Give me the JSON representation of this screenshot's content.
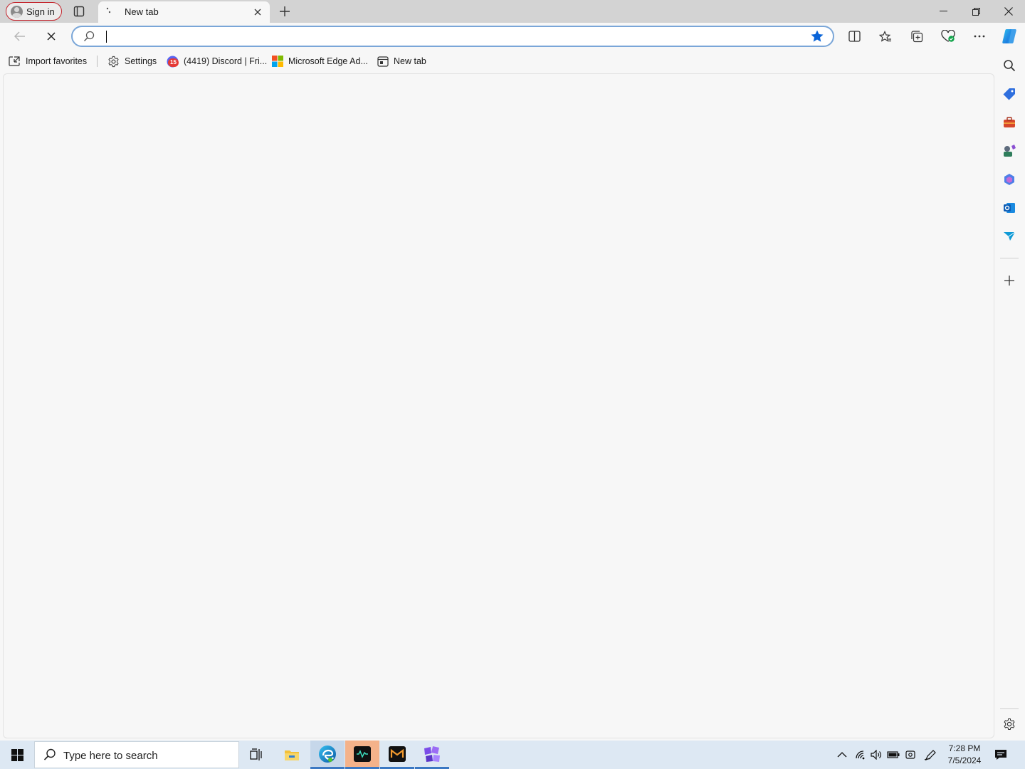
{
  "titlebar": {
    "signin_label": "Sign in",
    "tab_title": "New tab",
    "icons": [
      "profile-avatar-icon",
      "tab-actions-icon",
      "loading-icon",
      "close-icon",
      "plus-icon",
      "minimize-icon",
      "restore-icon",
      "window-close-icon"
    ]
  },
  "toolbar": {
    "address_value": "",
    "icons": [
      "back-arrow-icon",
      "stop-loading-icon",
      "search-icon",
      "favorite-star-icon",
      "split-screen-icon",
      "favorites-icon",
      "collections-icon",
      "browser-essentials-icon",
      "more-icon",
      "copilot-icon"
    ]
  },
  "favorites": [
    {
      "label": "Import favorites",
      "icon": "import-icon"
    },
    {
      "label": "Settings",
      "icon": "gear-icon"
    },
    {
      "label": "(4419) Discord | Fri...",
      "icon": "discord-icon",
      "badge": "15"
    },
    {
      "label": "Microsoft Edge Ad...",
      "icon": "microsoft-logo-icon"
    },
    {
      "label": "New tab",
      "icon": "new-tab-page-icon"
    }
  ],
  "sidebar": {
    "icons": [
      "search-icon",
      "shopping-tag-icon",
      "tools-icon",
      "games-icon",
      "microsoft-365-icon",
      "outlook-icon",
      "drop-icon",
      "add-icon",
      "settings-icon"
    ]
  },
  "taskbar": {
    "search_placeholder": "Type here to search",
    "time": "7:28 PM",
    "date": "7/5/2024",
    "apps": [
      "task-view-icon",
      "file-explorer-icon",
      "edge-icon",
      "app-waveform-icon",
      "app-m-icon",
      "app-puzzle-icon"
    ],
    "tray": [
      "chevron-up-icon",
      "network-icon",
      "volume-icon",
      "battery-icon",
      "camera-icon",
      "pen-icon",
      "notification-icon"
    ]
  },
  "colors": {
    "accent": "#0a64d8",
    "signin_border": "#c4262e",
    "taskbar": "#dde8f3"
  }
}
